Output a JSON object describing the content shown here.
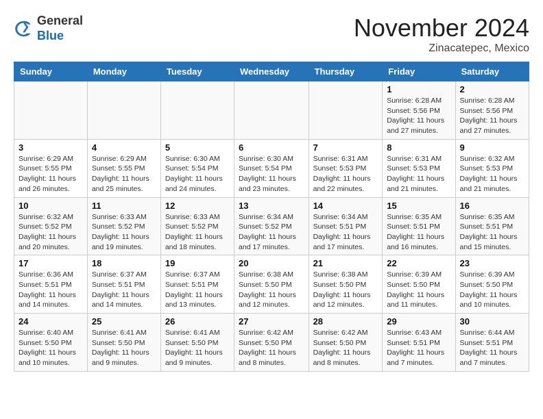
{
  "header": {
    "logo_general": "General",
    "logo_blue": "Blue",
    "month_title": "November 2024",
    "location": "Zinacatepec, Mexico"
  },
  "weekdays": [
    "Sunday",
    "Monday",
    "Tuesday",
    "Wednesday",
    "Thursday",
    "Friday",
    "Saturday"
  ],
  "weeks": [
    [
      {
        "day": "",
        "info": ""
      },
      {
        "day": "",
        "info": ""
      },
      {
        "day": "",
        "info": ""
      },
      {
        "day": "",
        "info": ""
      },
      {
        "day": "",
        "info": ""
      },
      {
        "day": "1",
        "info": "Sunrise: 6:28 AM\nSunset: 5:56 PM\nDaylight: 11 hours and 27 minutes."
      },
      {
        "day": "2",
        "info": "Sunrise: 6:28 AM\nSunset: 5:56 PM\nDaylight: 11 hours and 27 minutes."
      }
    ],
    [
      {
        "day": "3",
        "info": "Sunrise: 6:29 AM\nSunset: 5:55 PM\nDaylight: 11 hours and 26 minutes."
      },
      {
        "day": "4",
        "info": "Sunrise: 6:29 AM\nSunset: 5:55 PM\nDaylight: 11 hours and 25 minutes."
      },
      {
        "day": "5",
        "info": "Sunrise: 6:30 AM\nSunset: 5:54 PM\nDaylight: 11 hours and 24 minutes."
      },
      {
        "day": "6",
        "info": "Sunrise: 6:30 AM\nSunset: 5:54 PM\nDaylight: 11 hours and 23 minutes."
      },
      {
        "day": "7",
        "info": "Sunrise: 6:31 AM\nSunset: 5:53 PM\nDaylight: 11 hours and 22 minutes."
      },
      {
        "day": "8",
        "info": "Sunrise: 6:31 AM\nSunset: 5:53 PM\nDaylight: 11 hours and 21 minutes."
      },
      {
        "day": "9",
        "info": "Sunrise: 6:32 AM\nSunset: 5:53 PM\nDaylight: 11 hours and 21 minutes."
      }
    ],
    [
      {
        "day": "10",
        "info": "Sunrise: 6:32 AM\nSunset: 5:52 PM\nDaylight: 11 hours and 20 minutes."
      },
      {
        "day": "11",
        "info": "Sunrise: 6:33 AM\nSunset: 5:52 PM\nDaylight: 11 hours and 19 minutes."
      },
      {
        "day": "12",
        "info": "Sunrise: 6:33 AM\nSunset: 5:52 PM\nDaylight: 11 hours and 18 minutes."
      },
      {
        "day": "13",
        "info": "Sunrise: 6:34 AM\nSunset: 5:52 PM\nDaylight: 11 hours and 17 minutes."
      },
      {
        "day": "14",
        "info": "Sunrise: 6:34 AM\nSunset: 5:51 PM\nDaylight: 11 hours and 17 minutes."
      },
      {
        "day": "15",
        "info": "Sunrise: 6:35 AM\nSunset: 5:51 PM\nDaylight: 11 hours and 16 minutes."
      },
      {
        "day": "16",
        "info": "Sunrise: 6:35 AM\nSunset: 5:51 PM\nDaylight: 11 hours and 15 minutes."
      }
    ],
    [
      {
        "day": "17",
        "info": "Sunrise: 6:36 AM\nSunset: 5:51 PM\nDaylight: 11 hours and 14 minutes."
      },
      {
        "day": "18",
        "info": "Sunrise: 6:37 AM\nSunset: 5:51 PM\nDaylight: 11 hours and 14 minutes."
      },
      {
        "day": "19",
        "info": "Sunrise: 6:37 AM\nSunset: 5:51 PM\nDaylight: 11 hours and 13 minutes."
      },
      {
        "day": "20",
        "info": "Sunrise: 6:38 AM\nSunset: 5:50 PM\nDaylight: 11 hours and 12 minutes."
      },
      {
        "day": "21",
        "info": "Sunrise: 6:38 AM\nSunset: 5:50 PM\nDaylight: 11 hours and 12 minutes."
      },
      {
        "day": "22",
        "info": "Sunrise: 6:39 AM\nSunset: 5:50 PM\nDaylight: 11 hours and 11 minutes."
      },
      {
        "day": "23",
        "info": "Sunrise: 6:39 AM\nSunset: 5:50 PM\nDaylight: 11 hours and 10 minutes."
      }
    ],
    [
      {
        "day": "24",
        "info": "Sunrise: 6:40 AM\nSunset: 5:50 PM\nDaylight: 11 hours and 10 minutes."
      },
      {
        "day": "25",
        "info": "Sunrise: 6:41 AM\nSunset: 5:50 PM\nDaylight: 11 hours and 9 minutes."
      },
      {
        "day": "26",
        "info": "Sunrise: 6:41 AM\nSunset: 5:50 PM\nDaylight: 11 hours and 9 minutes."
      },
      {
        "day": "27",
        "info": "Sunrise: 6:42 AM\nSunset: 5:50 PM\nDaylight: 11 hours and 8 minutes."
      },
      {
        "day": "28",
        "info": "Sunrise: 6:42 AM\nSunset: 5:50 PM\nDaylight: 11 hours and 8 minutes."
      },
      {
        "day": "29",
        "info": "Sunrise: 6:43 AM\nSunset: 5:51 PM\nDaylight: 11 hours and 7 minutes."
      },
      {
        "day": "30",
        "info": "Sunrise: 6:44 AM\nSunset: 5:51 PM\nDaylight: 11 hours and 7 minutes."
      }
    ]
  ]
}
